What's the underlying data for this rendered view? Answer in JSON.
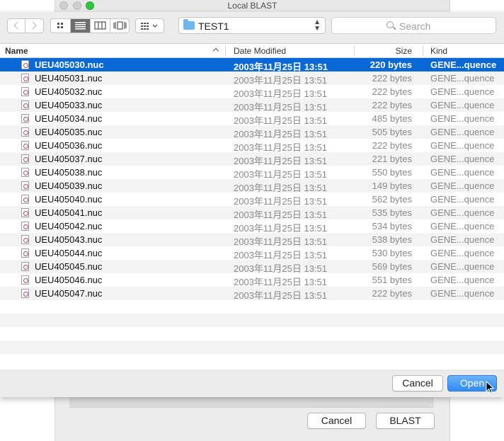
{
  "window": {
    "title": "Local BLAST"
  },
  "toolbar": {
    "location": "TEST1",
    "search_placeholder": "Search"
  },
  "columns": {
    "name": "Name",
    "date": "Date Modified",
    "size": "Size",
    "kind": "Kind"
  },
  "files": [
    {
      "name": "UEU405030.nuc",
      "date": "2003年11月25日 13:51",
      "size": "220 bytes",
      "kind": "GENE...quence"
    },
    {
      "name": "UEU405031.nuc",
      "date": "2003年11月25日 13:51",
      "size": "222 bytes",
      "kind": "GENE...quence"
    },
    {
      "name": "UEU405032.nuc",
      "date": "2003年11月25日 13:51",
      "size": "222 bytes",
      "kind": "GENE...quence"
    },
    {
      "name": "UEU405033.nuc",
      "date": "2003年11月25日 13:51",
      "size": "222 bytes",
      "kind": "GENE...quence"
    },
    {
      "name": "UEU405034.nuc",
      "date": "2003年11月25日 13:51",
      "size": "485 bytes",
      "kind": "GENE...quence"
    },
    {
      "name": "UEU405035.nuc",
      "date": "2003年11月25日 13:51",
      "size": "505 bytes",
      "kind": "GENE...quence"
    },
    {
      "name": "UEU405036.nuc",
      "date": "2003年11月25日 13:51",
      "size": "222 bytes",
      "kind": "GENE...quence"
    },
    {
      "name": "UEU405037.nuc",
      "date": "2003年11月25日 13:51",
      "size": "221 bytes",
      "kind": "GENE...quence"
    },
    {
      "name": "UEU405038.nuc",
      "date": "2003年11月25日 13:51",
      "size": "550 bytes",
      "kind": "GENE...quence"
    },
    {
      "name": "UEU405039.nuc",
      "date": "2003年11月25日 13:51",
      "size": "149 bytes",
      "kind": "GENE...quence"
    },
    {
      "name": "UEU405040.nuc",
      "date": "2003年11月25日 13:51",
      "size": "562 bytes",
      "kind": "GENE...quence"
    },
    {
      "name": "UEU405041.nuc",
      "date": "2003年11月25日 13:51",
      "size": "535 bytes",
      "kind": "GENE...quence"
    },
    {
      "name": "UEU405042.nuc",
      "date": "2003年11月25日 13:51",
      "size": "534 bytes",
      "kind": "GENE...quence"
    },
    {
      "name": "UEU405043.nuc",
      "date": "2003年11月25日 13:51",
      "size": "538 bytes",
      "kind": "GENE...quence"
    },
    {
      "name": "UEU405044.nuc",
      "date": "2003年11月25日 13:51",
      "size": "530 bytes",
      "kind": "GENE...quence"
    },
    {
      "name": "UEU405045.nuc",
      "date": "2003年11月25日 13:51",
      "size": "569 bytes",
      "kind": "GENE...quence"
    },
    {
      "name": "UEU405046.nuc",
      "date": "2003年11月25日 13:51",
      "size": "551 bytes",
      "kind": "GENE...quence"
    },
    {
      "name": "UEU405047.nuc",
      "date": "2003年11月25日 13:51",
      "size": "222 bytes",
      "kind": "GENE...quence"
    }
  ],
  "dialog": {
    "cancel": "Cancel",
    "open": "Open"
  },
  "main": {
    "cancel": "Cancel",
    "blast": "BLAST"
  },
  "colors": {
    "selection": "#0869d6",
    "open_button": "#2f8bf5"
  }
}
